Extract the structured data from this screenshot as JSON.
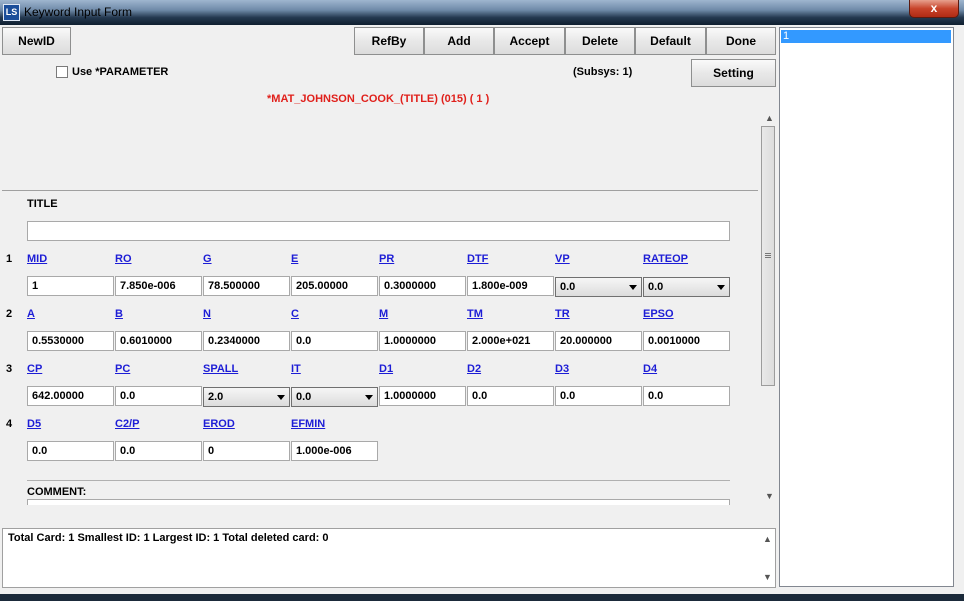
{
  "window": {
    "title": "Keyword Input Form",
    "close_glyph": "x"
  },
  "toolbar": {
    "newid": "NewID",
    "refby": "RefBy",
    "add": "Add",
    "accept": "Accept",
    "delete": "Delete",
    "default": "Default",
    "done": "Done",
    "setting": "Setting"
  },
  "options": {
    "use_parameter": "Use *PARAMETER",
    "subsys": "(Subsys: 1)"
  },
  "keyword": {
    "heading": "*MAT_JOHNSON_COOK_(TITLE) (015)   ( 1 )",
    "title_label": "TITLE",
    "title_value": "",
    "comment_label": "COMMENT:"
  },
  "cards": {
    "row1": {
      "num": "1",
      "labels": [
        "MID",
        "RO",
        "G",
        "E",
        "PR",
        "DTF",
        "VP",
        "RATEOP"
      ],
      "values": [
        "1",
        "7.850e-006",
        "78.500000",
        "205.00000",
        "0.3000000",
        "1.800e-009",
        "0.0",
        "0.0"
      ]
    },
    "row2": {
      "num": "2",
      "labels": [
        "A",
        "B",
        "N",
        "C",
        "M",
        "TM",
        "TR",
        "EPSO"
      ],
      "values": [
        "0.5530000",
        "0.6010000",
        "0.2340000",
        "0.0",
        "1.0000000",
        "2.000e+021",
        "20.000000",
        "0.0010000"
      ]
    },
    "row3": {
      "num": "3",
      "labels": [
        "CP",
        "PC",
        "SPALL",
        "IT",
        "D1",
        "D2",
        "D3",
        "D4"
      ],
      "values": [
        "642.00000",
        "0.0",
        "2.0",
        "0.0",
        "1.0000000",
        "0.0",
        "0.0",
        "0.0"
      ]
    },
    "row4": {
      "num": "4",
      "labels": [
        "D5",
        "C2/P",
        "EROD",
        "EFMIN"
      ],
      "values": [
        "0.0",
        "0.0",
        "0",
        "1.000e-006"
      ]
    }
  },
  "status": {
    "text": "Total Card: 1    Smallest ID: 1    Largest ID: 1    Total deleted card:  0"
  },
  "list": {
    "items": [
      "1"
    ]
  },
  "colors": {
    "heading": "#e0201b",
    "link": "#1d1dd6",
    "selection": "#3399ff"
  }
}
